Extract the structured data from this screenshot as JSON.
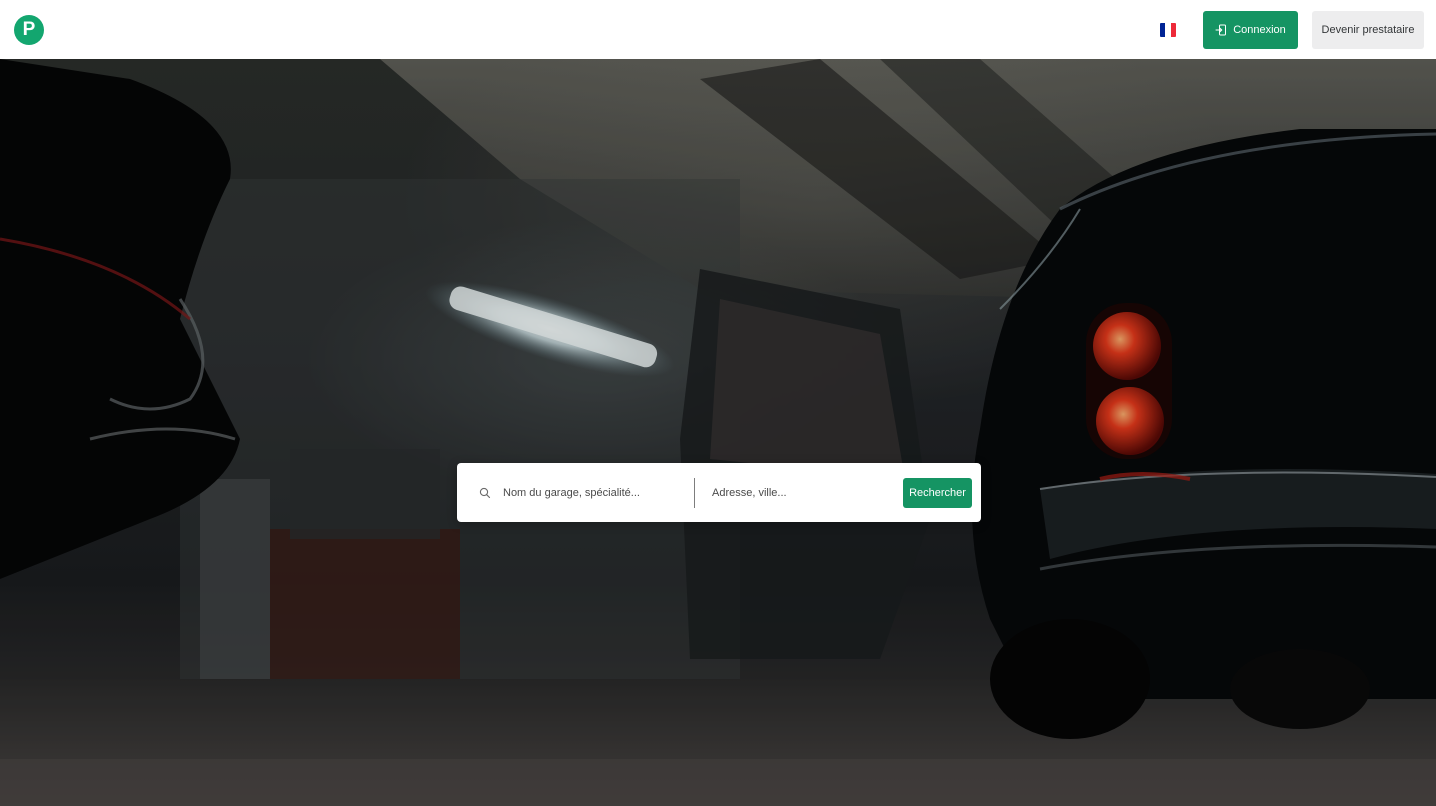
{
  "header": {
    "logo_letter": "P",
    "language_flag": "fr-flag-icon",
    "login_label": "Connexion",
    "provider_label": "Devenir prestataire"
  },
  "search": {
    "name_placeholder": "Nom du garage, spécialité...",
    "address_placeholder": "Adresse, ville...",
    "submit_label": "Rechercher"
  },
  "colors": {
    "brand_green": "#159463",
    "logo_green": "#13a66f",
    "provider_button_bg": "#ededee",
    "flag_blue": "#002395",
    "flag_white": "#ffffff",
    "flag_red": "#ed2939"
  },
  "icons": {
    "login": "login-icon",
    "search": "search-icon"
  }
}
